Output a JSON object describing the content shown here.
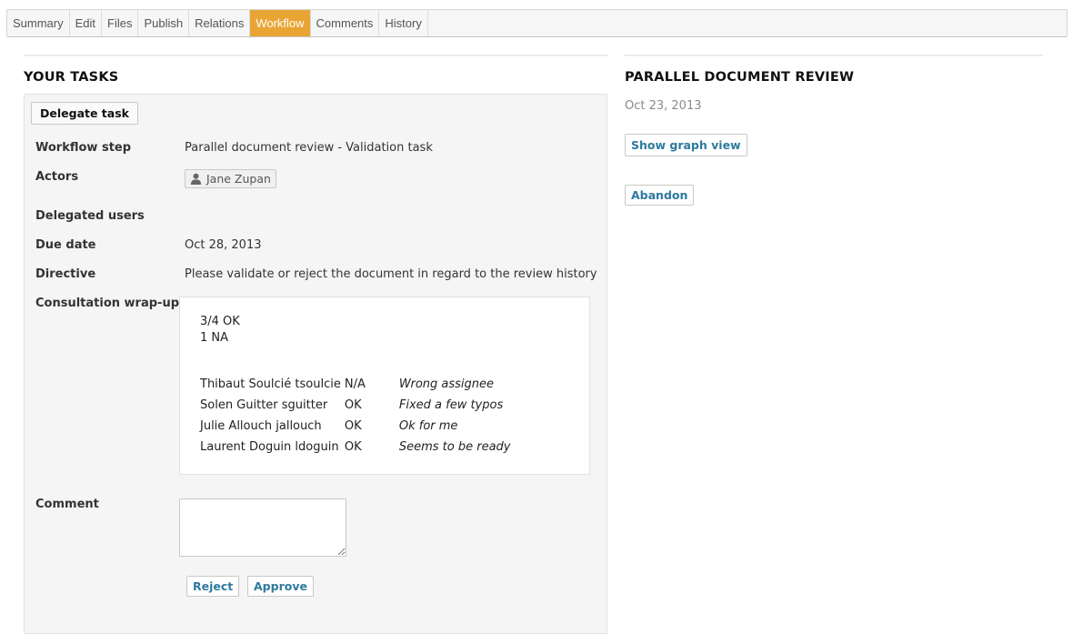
{
  "tabs": [
    {
      "label": "Summary",
      "active": false
    },
    {
      "label": "Edit",
      "active": false
    },
    {
      "label": "Files",
      "active": false
    },
    {
      "label": "Publish",
      "active": false
    },
    {
      "label": "Relations",
      "active": false
    },
    {
      "label": "Workflow",
      "active": true
    },
    {
      "label": "Comments",
      "active": false
    },
    {
      "label": "History",
      "active": false
    }
  ],
  "tasks": {
    "heading": "YOUR TASKS",
    "delegate_label": "Delegate task",
    "fields": {
      "workflow_step_label": "Workflow step",
      "workflow_step_value": "Parallel document review - Validation task",
      "actors_label": "Actors",
      "actor_name": "Jane Zupan",
      "delegated_users_label": "Delegated users",
      "due_date_label": "Due date",
      "due_date_value": "Oct 28, 2013",
      "directive_label": "Directive",
      "directive_value": "Please validate or reject the document in regard to the review history",
      "wrapup_label": "Consultation wrap-up",
      "comment_label": "Comment"
    },
    "wrapup": {
      "summary_line1": "3/4 OK",
      "summary_line2": "1 NA",
      "rows": [
        {
          "user": "Thibaut Soulcié tsoulcie",
          "status": "N/A",
          "comment": "Wrong assignee"
        },
        {
          "user": "Solen Guitter sguitter",
          "status": "OK",
          "comment": "Fixed a few typos"
        },
        {
          "user": "Julie Allouch jallouch",
          "status": "OK",
          "comment": "Ok for me"
        },
        {
          "user": "Laurent Doguin ldoguin",
          "status": "OK",
          "comment": "Seems to be ready"
        }
      ]
    },
    "comment_value": "",
    "reject_label": "Reject",
    "approve_label": "Approve"
  },
  "workflow": {
    "heading": "PARALLEL DOCUMENT REVIEW",
    "date": "Oct 23, 2013",
    "graph_label": "Show graph view",
    "abandon_label": "Abandon"
  },
  "colors": {
    "active_tab": "#e9a534",
    "link_blue": "#2d7a9e",
    "panel_bg": "#f5f5f5"
  }
}
